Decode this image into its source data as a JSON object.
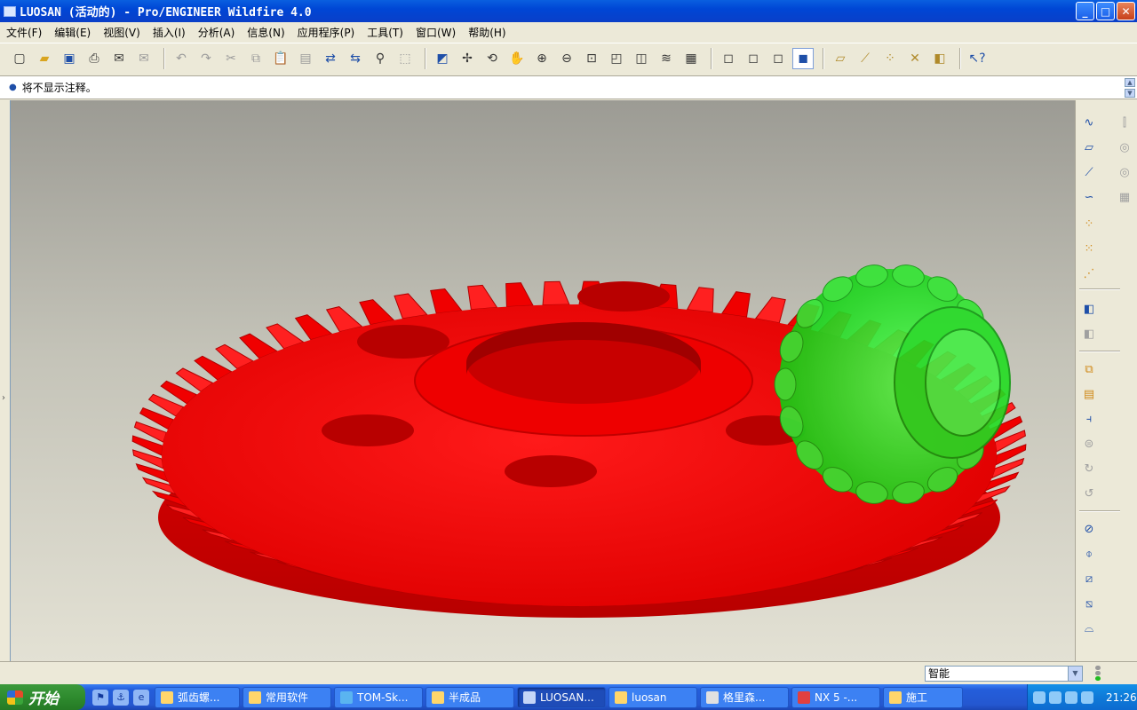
{
  "window": {
    "title": "LUOSAN (活动的) - Pro/ENGINEER Wildfire 4.0",
    "buttons": {
      "minimize": "_",
      "maximize": "□",
      "close": "✕"
    }
  },
  "menu": [
    "文件(F)",
    "编辑(E)",
    "视图(V)",
    "插入(I)",
    "分析(A)",
    "信息(N)",
    "应用程序(P)",
    "工具(T)",
    "窗口(W)",
    "帮助(H)"
  ],
  "toolbar": {
    "icons": [
      "new-icon",
      "open-icon",
      "save-icon",
      "print-icon",
      "email-icon",
      "email-link-icon",
      "undo-icon",
      "redo-icon",
      "cut-icon",
      "copy-icon",
      "paste-icon",
      "paste-special-icon",
      "regenerate-icon",
      "regen-manager-icon",
      "find-icon",
      "select-box-icon",
      "repaint-icon",
      "spin-center-icon",
      "orient-mode-icon",
      "pan-icon",
      "zoom-in-icon",
      "zoom-out-icon",
      "refit-icon",
      "reorient-icon",
      "saved-views-icon",
      "layers-icon",
      "view-manager-icon",
      "wireframe-icon",
      "hidden-line-icon",
      "no-hidden-icon",
      "shading-icon",
      "datum-planes-icon",
      "datum-axes-icon",
      "datum-points-icon",
      "coord-systems-icon",
      "annotations-icon",
      "context-help-icon"
    ]
  },
  "message": {
    "text": "将不显示注释。"
  },
  "right_toolbar": {
    "icons": [
      "sketch-tool-icon",
      "datum-plane-icon",
      "datum-axis-icon",
      "datum-curve-icon",
      "datum-point-icon",
      "point-offset-icon",
      "point-field-icon",
      "annotation-feature-icon",
      "annotation-feature-2-icon",
      "copy-paste-icon",
      "paste-special-icon",
      "extrude-icon",
      "revolve-icon",
      "sweep-icon",
      "blend-icon",
      "hole-icon",
      "round-icon",
      "shell-icon",
      "rib-icon",
      "draft-icon",
      "mirror-icon",
      "merge-icon",
      "pattern-icon",
      "trim-icon"
    ]
  },
  "status": {
    "filter_value": "智能"
  },
  "taskbar": {
    "start_label": "开始",
    "tasks": [
      "弧齿螺...",
      "常用软件",
      "TOM-Sk...",
      "半成品",
      "LUOSAN...",
      "luosan",
      "格里森...",
      "NX 5 -...",
      "施工"
    ],
    "active_task": "LUOSAN...",
    "clock": "21:26"
  },
  "colors": {
    "gear_red": "#ff0000",
    "pinion_green": "#22ee22",
    "xp_blue": "#245edb"
  }
}
